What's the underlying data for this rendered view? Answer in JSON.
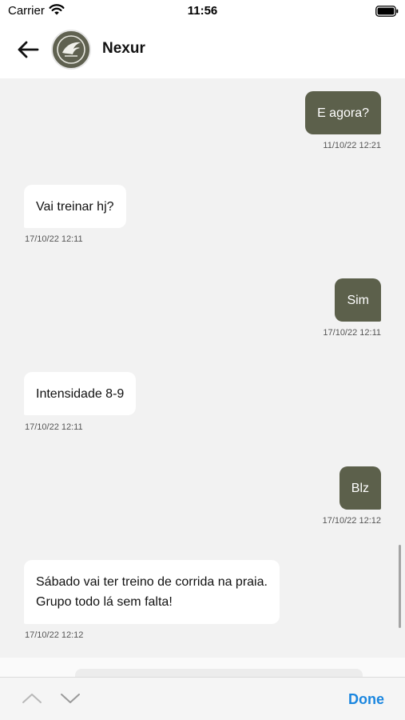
{
  "status_bar": {
    "carrier": "Carrier",
    "time": "11:56"
  },
  "header": {
    "contact_name": "Nexur"
  },
  "messages": [
    {
      "direction": "outgoing",
      "text": "E agora?",
      "timestamp": "11/10/22 12:21"
    },
    {
      "direction": "incoming",
      "text": "Vai treinar hj?",
      "timestamp": "17/10/22 12:11"
    },
    {
      "direction": "outgoing",
      "text": "Sim",
      "timestamp": "17/10/22 12:11"
    },
    {
      "direction": "incoming",
      "text": "Intensidade 8-9",
      "timestamp": "17/10/22 12:11"
    },
    {
      "direction": "outgoing",
      "text": "Blz",
      "timestamp": "17/10/22 12:12"
    },
    {
      "direction": "incoming",
      "text_lines": [
        "Sábado vai ter treino de corrida na praia.",
        "Grupo todo lá sem falta!"
      ],
      "timestamp": "17/10/22 12:12"
    }
  ],
  "toolbar": {
    "done_label": "Done"
  },
  "colors": {
    "outgoing_bubble": "#5c604b",
    "incoming_bubble": "#ffffff",
    "background": "#f2f2f2",
    "accent": "#1a86df"
  },
  "icons": {
    "back": "arrow-left-icon",
    "previous": "chevron-up-icon",
    "next": "chevron-down-icon",
    "wifi": "wifi-icon",
    "battery": "battery-icon"
  }
}
